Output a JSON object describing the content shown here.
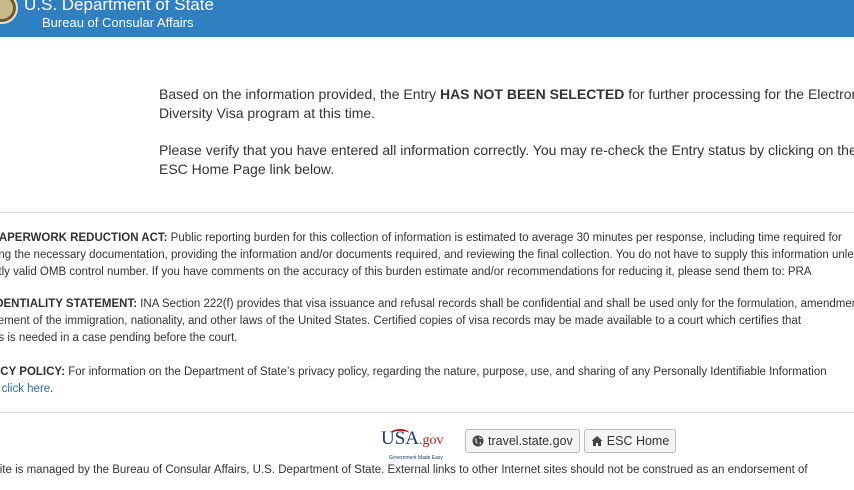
{
  "header": {
    "title": "U.S. Department of State",
    "subtitle": "Bureau of Consular Affairs"
  },
  "message": {
    "p1_before": "Based on the information provided, the Entry ",
    "p1_strong": "HAS NOT BEEN SELECTED",
    "p1_after": " for further processing for the Electronic Diversity Visa program at this time.",
    "p2": "Please verify that you have entered all information correctly. You may re-check the Entry status by clicking on the ESC Home Page link below."
  },
  "legal": {
    "paperwork_heading": "PAPERWORK REDUCTION ACT:",
    "paperwork_line1": " Public reporting burden for this collection of information is estimated to average 30 minutes per response, including time required for",
    "paperwork_line2": "ring the necessary documentation, providing the information and/or documents required, and reviewing the final collection. You do not have to supply this information unless",
    "paperwork_line3": "ntly valid OMB control number. If you have comments on the accuracy of this burden estimate and/or recommendations for reducing it, please send them to: PRA",
    "confidentiality_heading": "IDENTIALITY STATEMENT:",
    "confidentiality_line1": " INA Section 222(f) provides that visa issuance and refusal records shall be confidential and shall be used only for the formulation, amendment,",
    "confidentiality_line2": "cement of the immigration, nationality, and other laws of the United States. Certified copies of visa records may be made available to a court which certifies that",
    "confidentiality_line3": "ds is needed in a case pending before the court.",
    "privacy_heading": "ACY POLICY:",
    "privacy_line1": " For information on the Department of State’s privacy policy, regarding the nature, purpose, use, and sharing of any Personally Identifiable Information",
    "privacy_line2_before": "e ",
    "privacy_link": "click here",
    "privacy_line2_after": "."
  },
  "footer": {
    "usa_logo_text": "USA",
    "usa_logo_dot": ".gov",
    "usa_logo_tagline": "Government Made Easy",
    "travel_button": "travel.state.gov",
    "esc_button": "ESC Home",
    "note": "site is managed by the Bureau of Consular Affairs, U.S. Department of State. External links to other Internet sites should not be construed as an endorsement of"
  },
  "icons": {
    "seal": "department-seal-icon",
    "globe": "globe-icon",
    "home": "home-icon"
  },
  "colors": {
    "header_bg": "#2f7fc1",
    "link": "#2f6ea8"
  }
}
